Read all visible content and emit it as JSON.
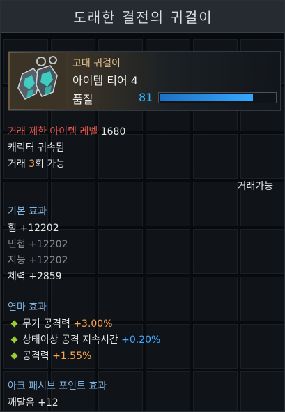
{
  "title": "도래한 결전의 귀걸이",
  "item": {
    "grade": "고대 귀걸이",
    "tier": "아이템 티어 4",
    "quality_label": "품질",
    "quality_value": "81",
    "quality_fraction": 0.81,
    "icon": "earring-icon"
  },
  "restriction": {
    "label": "거래 제한 아이템 레벨",
    "value": "1680"
  },
  "binding": "캐릭터 귀속됨",
  "trade": {
    "prefix": "거래 ",
    "count": "3",
    "suffix": "회 가능"
  },
  "tradable": "거래가능",
  "basic_effect": {
    "heading": "기본 효과",
    "stats": [
      {
        "label": "힘 +12202",
        "active": true
      },
      {
        "label": "민첩 +12202",
        "active": false
      },
      {
        "label": "지능 +12202",
        "active": false
      },
      {
        "label": "체력 +2859",
        "active": true
      }
    ]
  },
  "refine_effect": {
    "heading": "연마 효과",
    "lines": [
      {
        "name": "무기 공격력 ",
        "value": "+3.00%",
        "color": "#ffa64d"
      },
      {
        "name": "상태이상 공격 지속시간 ",
        "value": "+0.20%",
        "color": "#44a9ff"
      },
      {
        "name": "공격력 ",
        "value": "+1.55%",
        "color": "#ffa64d"
      }
    ]
  },
  "ark_passive": {
    "heading": "아크 패시브 포인트 효과",
    "line": "깨달음 +12"
  },
  "colors": {
    "header_bg": "#252b30",
    "section_heading": "#7fb3e0",
    "quality_blue": "#2fb6ff",
    "restriction_red": "#e8554e"
  }
}
